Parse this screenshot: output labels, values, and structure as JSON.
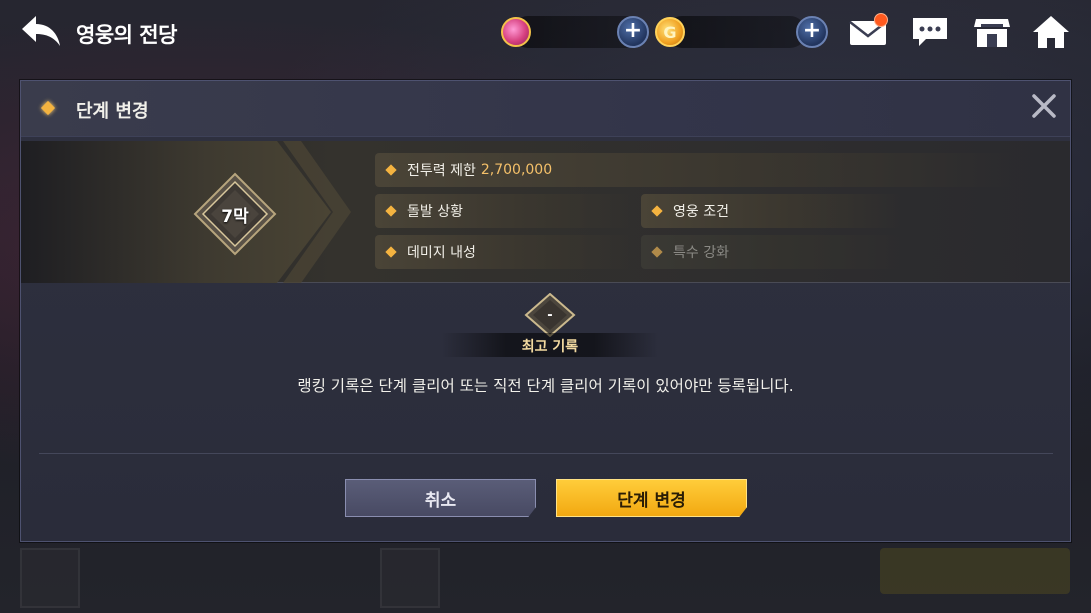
{
  "topbar": {
    "title": "영웅의 전당",
    "gold_symbol": "G",
    "icons": [
      "back-arrow-icon",
      "gem-currency-icon",
      "plus-icon",
      "gold-currency-icon",
      "plus-icon",
      "mail-icon",
      "chat-icon",
      "shop-icon",
      "home-icon"
    ],
    "notification_color": "#ff5a1f"
  },
  "modal": {
    "title": "단계 변경",
    "stage_label": "7막",
    "conditions": [
      {
        "label": "전투력 제한",
        "value": "2,700,000",
        "active": true
      },
      {
        "label": "돌발 상황",
        "active": true
      },
      {
        "label": "영웅 조건",
        "active": true
      },
      {
        "label": "데미지 내성",
        "active": true
      },
      {
        "label": "특수 강화",
        "active": false
      }
    ],
    "record": {
      "value": "-",
      "label": "최고 기록"
    },
    "notice": "랭킹 기록은 단계 클리어 또는 직전 단계 클리어 기록이 있어야만 등록됩니다.",
    "buttons": {
      "cancel": "취소",
      "confirm": "단계 변경"
    }
  },
  "colors": {
    "accent_gold": "#f4b340",
    "confirm_button": "#f2a811",
    "cancel_button": "#484a63",
    "highlight_value": "#f4c069"
  }
}
